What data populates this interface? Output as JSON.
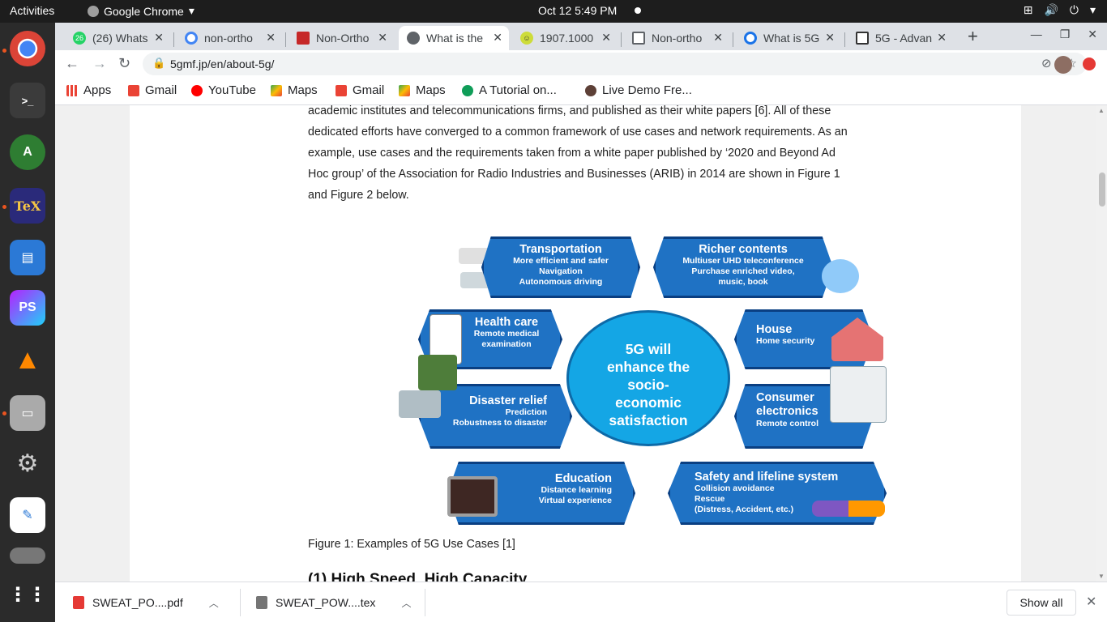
{
  "system_bar": {
    "activities": "Activities",
    "app_name": "Google Chrome",
    "datetime": "Oct 12  5:49 PM"
  },
  "dock": {
    "items": [
      "chrome-icon",
      "terminal-icon",
      "android-studio-icon",
      "texmaker-icon",
      "document-viewer-icon",
      "phpstorm-icon",
      "vlc-icon",
      "files-icon",
      "settings-icon",
      "text-editor-icon",
      "drive-icon",
      "show-apps-icon"
    ]
  },
  "tabs": [
    {
      "title": "(26) Whats",
      "badge": "26"
    },
    {
      "title": "non-ortho"
    },
    {
      "title": "Non-Ortho"
    },
    {
      "title": "What is the"
    },
    {
      "title": "1907.1000"
    },
    {
      "title": "Non-ortho"
    },
    {
      "title": "What is 5G"
    },
    {
      "title": "5G - Advan"
    }
  ],
  "omnibox": {
    "url": "5gmf.jp/en/about-5g/"
  },
  "bookmarks": [
    {
      "label": "Apps",
      "icon": "apps-grid-icon"
    },
    {
      "label": "Gmail",
      "icon": "gmail-icon"
    },
    {
      "label": "YouTube",
      "icon": "youtube-icon"
    },
    {
      "label": "Maps",
      "icon": "maps-icon"
    },
    {
      "label": "Gmail",
      "icon": "gmail-icon"
    },
    {
      "label": "Maps",
      "icon": "maps-icon"
    },
    {
      "label": "A Tutorial on...",
      "icon": "tutorial-icon"
    },
    {
      "label": "Live Demo Fre...",
      "icon": "live-demo-icon"
    }
  ],
  "article": {
    "paragraph": "academic institutes and telecommunications firms, and published as their white papers [6]. All of these dedicated efforts have converged to a common framework of use cases and network requirements. As an example, use cases and the requirements taken from a white paper published by ‘2020 and Beyond Ad Hoc group’ of the Association for Radio Industries and Businesses (ARIB) in 2014 are shown in Figure 1 and Figure 2 below.",
    "caption": "Figure 1: Examples of 5G Use Cases [1]",
    "next_heading": "(1) High Speed, High Capacity"
  },
  "figure": {
    "center": [
      "5G will",
      "enhance the",
      "socio-",
      "economic",
      "satisfaction"
    ],
    "use_cases": [
      {
        "key": "transportation",
        "title": "Transportation",
        "lines": [
          "More efficient and safer",
          "Navigation",
          "Autonomous driving"
        ]
      },
      {
        "key": "richer",
        "title": "Richer contents",
        "lines": [
          "Multiuser UHD teleconference",
          "Purchase enriched video,",
          "music, book"
        ]
      },
      {
        "key": "health",
        "title": "Health care",
        "lines": [
          "Remote medical",
          "examination"
        ]
      },
      {
        "key": "house",
        "title": "House",
        "lines": [
          "Home security"
        ]
      },
      {
        "key": "disaster",
        "title": "Disaster relief",
        "lines": [
          "Prediction",
          "Robustness to disaster"
        ]
      },
      {
        "key": "consumer",
        "title": "Consumer electronics",
        "lines": [
          "Remote control"
        ]
      },
      {
        "key": "education",
        "title": "Education",
        "lines": [
          "Distance learning",
          "Virtual experience"
        ]
      },
      {
        "key": "safety",
        "title": "Safety and lifeline system",
        "lines": [
          "Collision avoidance",
          "Rescue",
          "(Distress, Accident, etc.)"
        ]
      }
    ]
  },
  "downloads": [
    {
      "name": "SWEAT_PO....pdf",
      "type": "pdf"
    },
    {
      "name": "SWEAT_POW....tex",
      "type": "tex"
    }
  ],
  "shelf": {
    "show_all": "Show all"
  },
  "colors": {
    "pill_blue": "#1f72c4",
    "center_blue": "#14a6e5",
    "ubuntu_orange": "#e95420"
  }
}
